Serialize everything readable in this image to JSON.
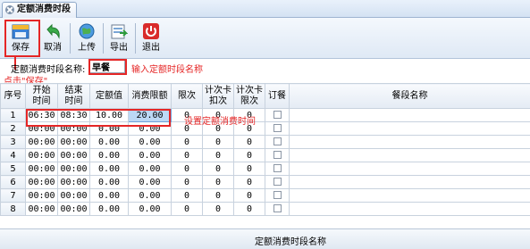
{
  "tab": {
    "title": "定额消费时段"
  },
  "toolbar": {
    "save": "保存",
    "cancel": "取消",
    "upload": "上传",
    "export": "导出",
    "exit": "退出"
  },
  "name_field": {
    "label": "定额消费时段名称:",
    "value": "早餐"
  },
  "annotations": {
    "input_name": "输入定额时段名称",
    "click_save": "点击\"保存\"",
    "set_time": "设置定额消费时间"
  },
  "columns": [
    "序号",
    "开始\n时间",
    "结束\n时间",
    "定额值",
    "消费限额",
    "限次",
    "计次卡\n扣次",
    "计次卡\n限次",
    "订餐",
    "餐段名称"
  ],
  "rows": [
    {
      "no": "1",
      "start": "06:30",
      "end": "08:30",
      "quota": "10.00",
      "limit": "20.00",
      "times": "0",
      "deduct": "0",
      "cap": "0"
    },
    {
      "no": "2",
      "start": "00:00",
      "end": "00:00",
      "quota": "0.00",
      "limit": "0.00",
      "times": "0",
      "deduct": "0",
      "cap": "0"
    },
    {
      "no": "3",
      "start": "00:00",
      "end": "00:00",
      "quota": "0.00",
      "limit": "0.00",
      "times": "0",
      "deduct": "0",
      "cap": "0"
    },
    {
      "no": "4",
      "start": "00:00",
      "end": "00:00",
      "quota": "0.00",
      "limit": "0.00",
      "times": "0",
      "deduct": "0",
      "cap": "0"
    },
    {
      "no": "5",
      "start": "00:00",
      "end": "00:00",
      "quota": "0.00",
      "limit": "0.00",
      "times": "0",
      "deduct": "0",
      "cap": "0"
    },
    {
      "no": "6",
      "start": "00:00",
      "end": "00:00",
      "quota": "0.00",
      "limit": "0.00",
      "times": "0",
      "deduct": "0",
      "cap": "0"
    },
    {
      "no": "7",
      "start": "00:00",
      "end": "00:00",
      "quota": "0.00",
      "limit": "0.00",
      "times": "0",
      "deduct": "0",
      "cap": "0"
    },
    {
      "no": "8",
      "start": "00:00",
      "end": "00:00",
      "quota": "0.00",
      "limit": "0.00",
      "times": "0",
      "deduct": "0",
      "cap": "0"
    }
  ],
  "footer": {
    "label": "定额消费时段名称"
  },
  "colors": {
    "annotation": "#e52626",
    "selected_cell": "#bcd8f5",
    "exit_icon": "#d92b2b"
  }
}
